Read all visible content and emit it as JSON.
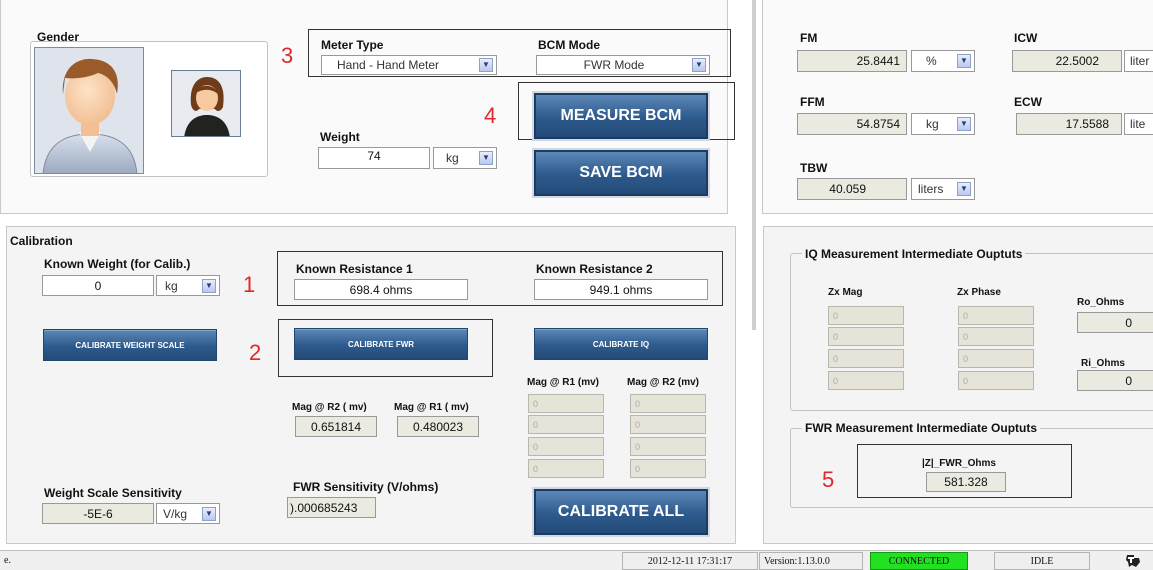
{
  "gender": {
    "label": "Gender"
  },
  "meter": {
    "type_label": "Meter Type",
    "type_value": "Hand - Hand Meter",
    "mode_label": "BCM Mode",
    "mode_value": "FWR Mode"
  },
  "weight": {
    "label": "Weight",
    "value": "74",
    "unit": "kg"
  },
  "buttons": {
    "measure": "MEASURE BCM",
    "save": "SAVE BCM",
    "cal_weight": "CALIBRATE WEIGHT SCALE",
    "cal_fwr": "CALIBRATE FWR",
    "cal_iq": "CALIBRATE IQ",
    "cal_all": "CALIBRATE ALL"
  },
  "annotations": [
    "1",
    "2",
    "3",
    "4",
    "5"
  ],
  "results": {
    "fm": {
      "label": "FM",
      "value": "25.8441",
      "unit": "%"
    },
    "ffm": {
      "label": "FFM",
      "value": "54.8754",
      "unit": "kg"
    },
    "tbw": {
      "label": "TBW",
      "value": "40.059",
      "unit": "liters"
    },
    "icw": {
      "label": "ICW",
      "value": "22.5002",
      "unit": "liter"
    },
    "ecw": {
      "label": "ECW",
      "value": "17.5588",
      "unit": "lite"
    }
  },
  "calibration": {
    "title": "Calibration",
    "known_weight_label": "Known Weight (for Calib.)",
    "known_weight_value": "0",
    "known_weight_unit": "kg",
    "kr1_label": "Known Resistance 1",
    "kr1_value": "698.4  ohms",
    "kr2_label": "Known Resistance 2",
    "kr2_value": "949.1  ohms",
    "mag_r2_label": "Mag @ R2 ( mv)",
    "mag_r2_value": "0.651814",
    "mag_r1_label": "Mag @ R1 ( mv)",
    "mag_r1_value": "0.480023",
    "iq_mag_r1_label": "Mag @ R1 (mv)",
    "iq_mag_r2_label": "Mag @ R2 (mv)",
    "iq_mag_r1_values": [
      "0",
      "0",
      "0",
      "0"
    ],
    "iq_mag_r2_values": [
      "0",
      "0",
      "0",
      "0"
    ],
    "fwr_sens_label": "FWR Sensitivity (V/ohms)",
    "fwr_sens_value": ").000685243",
    "wss_label": "Weight Scale Sensitivity",
    "wss_value": "-5E-6",
    "wss_unit": "V/kg"
  },
  "iq": {
    "title": "IQ Measurement Intermediate Ouptuts",
    "zx_mag_label": "Zx Mag",
    "zx_phase_label": "Zx Phase",
    "zx_mag_values": [
      "0",
      "0",
      "0",
      "0"
    ],
    "zx_phase_values": [
      "0",
      "0",
      "0",
      "0"
    ],
    "ro_label": "Ro_Ohms",
    "ro_value": "0",
    "ri_label": "Ri_Ohms",
    "ri_value": "0"
  },
  "fwr": {
    "title": "FWR Measurement Intermediate Ouptuts",
    "z_label": "|Z|_FWR_Ohms",
    "z_value": "581.328"
  },
  "status": {
    "left": "e.",
    "datetime": "2012-12-11 17:31:17",
    "version": "Version:1.13.0.0",
    "connected": "CONNECTED",
    "state": "IDLE"
  },
  "colors": {
    "connected": "#22e022",
    "annotation": "#e0282c",
    "button": "#2d5a8c"
  }
}
